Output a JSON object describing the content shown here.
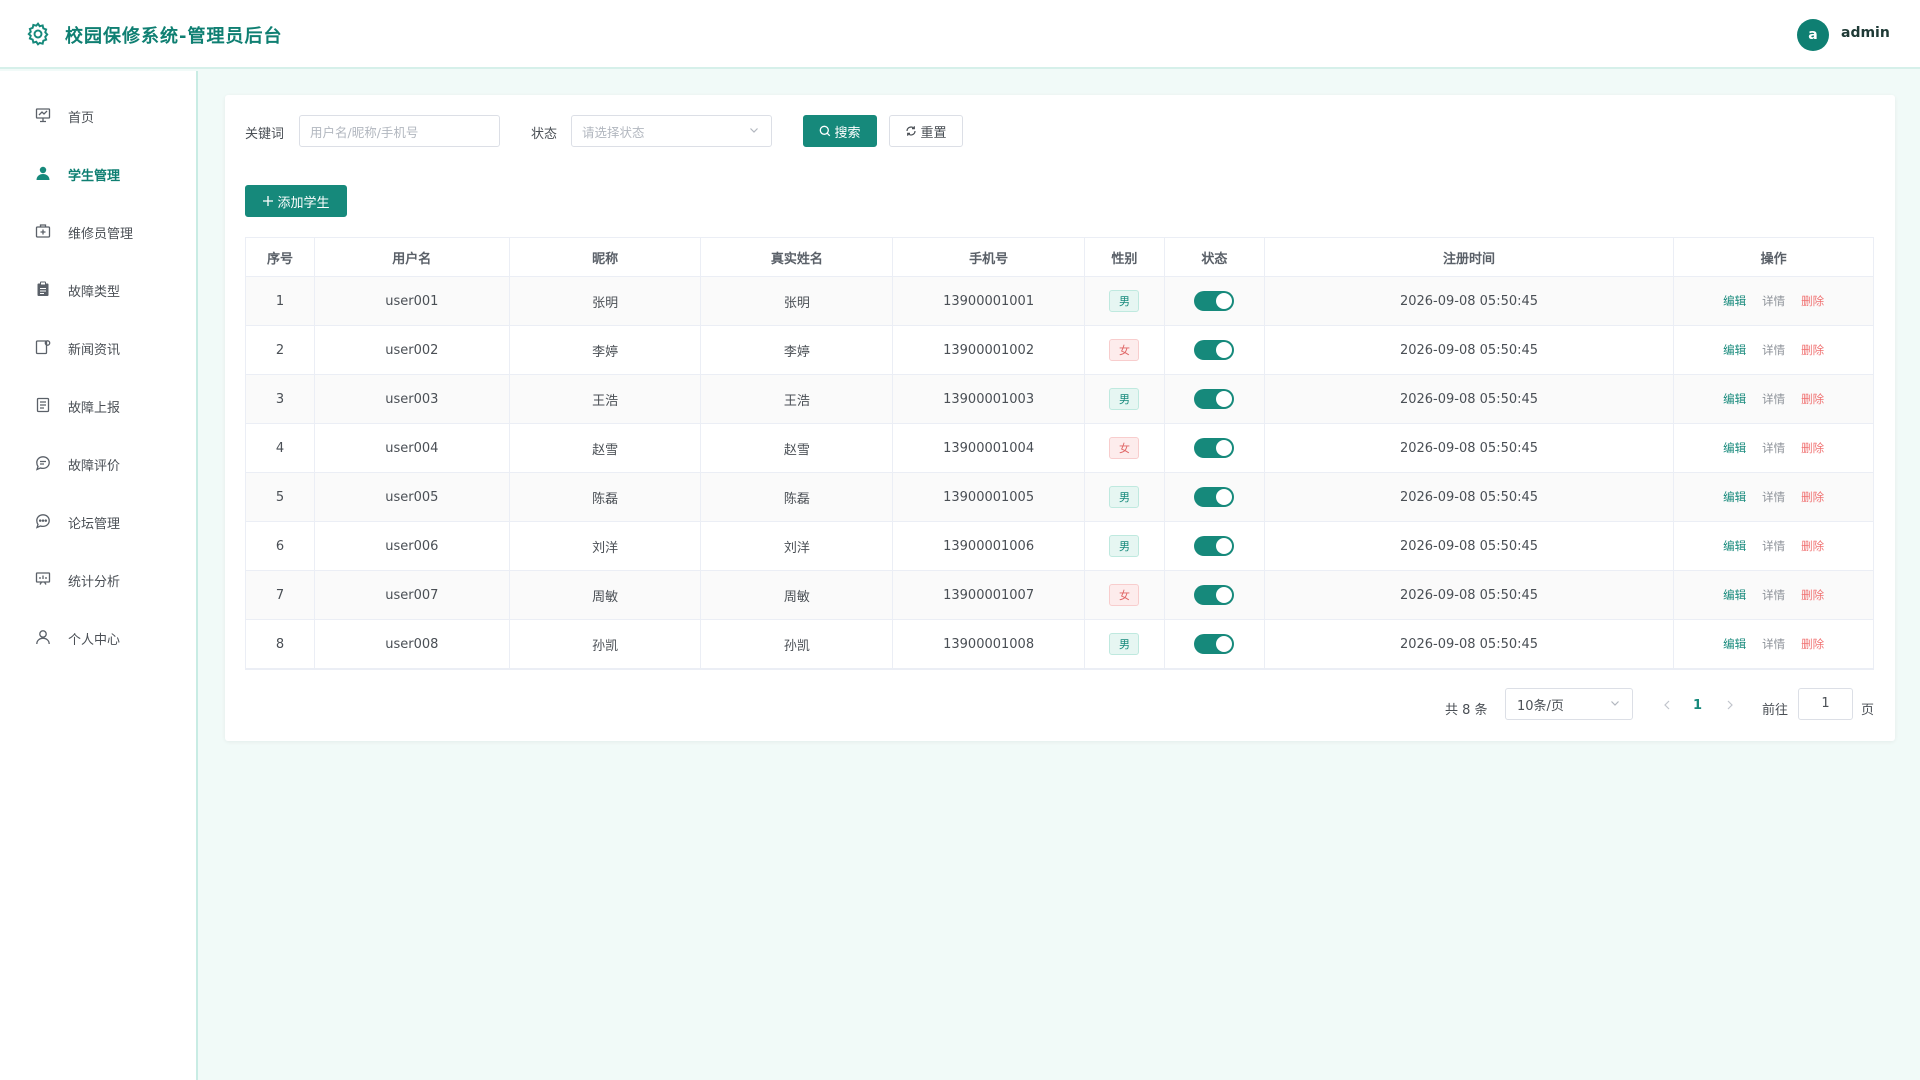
{
  "header": {
    "title": "校园保修系统-管理员后台",
    "user_avatar_letter": "a",
    "user_name": "admin"
  },
  "sidebar": {
    "items": [
      {
        "label": "首页",
        "icon": "presentation-icon"
      },
      {
        "label": "学生管理",
        "icon": "user-filled-icon",
        "active": true
      },
      {
        "label": "维修员管理",
        "icon": "first-aid-icon"
      },
      {
        "label": "故障类型",
        "icon": "clipboard-icon"
      },
      {
        "label": "新闻资讯",
        "icon": "news-icon"
      },
      {
        "label": "故障上报",
        "icon": "document-icon"
      },
      {
        "label": "故障评价",
        "icon": "chat-icon"
      },
      {
        "label": "论坛管理",
        "icon": "chat-dots-icon"
      },
      {
        "label": "统计分析",
        "icon": "data-board-icon"
      },
      {
        "label": "个人中心",
        "icon": "user-icon"
      }
    ]
  },
  "filters": {
    "keyword_label": "关键词",
    "keyword_placeholder": "用户名/昵称/手机号",
    "status_label": "状态",
    "status_placeholder": "请选择状态",
    "search_label": "搜索",
    "reset_label": "重置"
  },
  "add_button_label": "添加学生",
  "table": {
    "columns": [
      "序号",
      "用户名",
      "昵称",
      "真实姓名",
      "手机号",
      "性别",
      "状态",
      "注册时间",
      "操作"
    ],
    "rows": [
      {
        "index": "1",
        "username": "user001",
        "nickname": "张明",
        "realname": "张明",
        "phone": "13900001001",
        "gender": "男",
        "status_on": true,
        "registered": "2026-09-08 05:50:45"
      },
      {
        "index": "2",
        "username": "user002",
        "nickname": "李婷",
        "realname": "李婷",
        "phone": "13900001002",
        "gender": "女",
        "status_on": true,
        "registered": "2026-09-08 05:50:45"
      },
      {
        "index": "3",
        "username": "user003",
        "nickname": "王浩",
        "realname": "王浩",
        "phone": "13900001003",
        "gender": "男",
        "status_on": true,
        "registered": "2026-09-08 05:50:45"
      },
      {
        "index": "4",
        "username": "user004",
        "nickname": "赵雪",
        "realname": "赵雪",
        "phone": "13900001004",
        "gender": "女",
        "status_on": true,
        "registered": "2026-09-08 05:50:45"
      },
      {
        "index": "5",
        "username": "user005",
        "nickname": "陈磊",
        "realname": "陈磊",
        "phone": "13900001005",
        "gender": "男",
        "status_on": true,
        "registered": "2026-09-08 05:50:45"
      },
      {
        "index": "6",
        "username": "user006",
        "nickname": "刘洋",
        "realname": "刘洋",
        "phone": "13900001006",
        "gender": "男",
        "status_on": true,
        "registered": "2026-09-08 05:50:45"
      },
      {
        "index": "7",
        "username": "user007",
        "nickname": "周敏",
        "realname": "周敏",
        "phone": "13900001007",
        "gender": "女",
        "status_on": true,
        "registered": "2026-09-08 05:50:45"
      },
      {
        "index": "8",
        "username": "user008",
        "nickname": "孙凯",
        "realname": "孙凯",
        "phone": "13900001008",
        "gender": "男",
        "status_on": true,
        "registered": "2026-09-08 05:50:45"
      }
    ],
    "actions": {
      "edit": "编辑",
      "detail": "详情",
      "delete": "删除"
    }
  },
  "pagination": {
    "total_text": "共 8 条",
    "page_size": "10条/页",
    "current_page": "1",
    "goto_label": "前往",
    "goto_value": "1",
    "page_suffix": "页"
  },
  "colors": {
    "primary": "#16897b",
    "danger": "#f07070"
  }
}
